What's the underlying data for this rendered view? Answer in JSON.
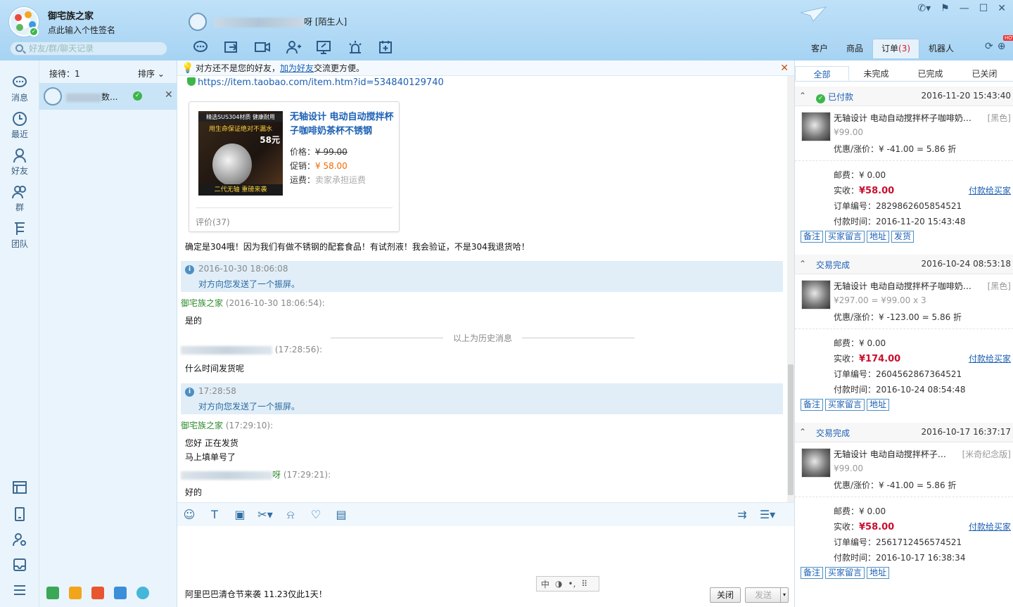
{
  "app": {
    "title": "御宅族之家",
    "signature": "点此输入个性签名",
    "search_placeholder": "好友/群/聊天记录"
  },
  "chat_header": {
    "contact_suffix": "呀",
    "contact_tag": "[陌生人]"
  },
  "right_tabs": {
    "customer": "客户",
    "goods": "商品",
    "orders": "订单",
    "orders_count": "(3)",
    "robot": "机器人",
    "hot": "HOT"
  },
  "leftnav": [
    {
      "label": "消息"
    },
    {
      "label": "最近"
    },
    {
      "label": "好友"
    },
    {
      "label": "群"
    },
    {
      "label": "团队"
    }
  ],
  "contacts": {
    "reception": "接待：1",
    "sort": "排序",
    "item_name_suffix": "数..."
  },
  "notice": {
    "text": "对方还不是您的好友，",
    "link": "加为好友",
    "after": "交流更方便。"
  },
  "messages": {
    "link": "https://item.taobao.com/item.htm?id=534840129740",
    "product": {
      "title": "无轴设计 电动自动搅拌杯子咖啡奶茶杯不锈钢",
      "price_label": "价格：",
      "price": "¥ 99.00",
      "promo_label": "促销：",
      "promo": "¥ 58.00",
      "ship_label": "运费：",
      "ship": "卖家承担运费",
      "reviews": "评价(37)",
      "img_top": "精选SUS304材质 健康耐用",
      "img_line2": "用生命保证绝对不漏水",
      "img_price": "58元",
      "img_bottom": "二代无轴 重磅来袭"
    },
    "m1": "确定是304哦！因为我们有做不锈钢的配套食品！有试剂液！我会验证，不是304我退货哈！",
    "sys1_time": "2016-10-30 18:06:08",
    "sys1_text": "对方向您发送了一个振屏。",
    "s1_name": "御宅族之家",
    "s1_time": "(2016-10-30 18:06:54):",
    "m2": "是的",
    "history": "以上为历史消息",
    "s2_time": "(17:28:56):",
    "m3": "什么时间发货呢",
    "sys2_time": "17:28:58",
    "sys2_text": "对方向您发送了一个振屏。",
    "s3_name": "御宅族之家",
    "s3_time": "(17:29:10):",
    "m4a": "您好  正在发货",
    "m4b": "马上填单号了",
    "s4_suffix": "呀",
    "s4_time": "(17:29:21):",
    "m5": "好的"
  },
  "input": {
    "ad": "阿里巴巴清仓节来袭 11.23仅此1天！",
    "close": "关闭",
    "send": "发送",
    "ime": "中"
  },
  "orders": {
    "tabs": [
      "全部",
      "未完成",
      "已完成",
      "已关闭"
    ],
    "groups": [
      {
        "status": "已付款",
        "date": "2016-11-20 15:43:40",
        "title": "无轴设计 电动自动搅拌杯子咖啡奶茶...",
        "color": "[黑色]",
        "price": "¥99.00",
        "disc": "优惠/涨价：¥ -41.00 = 5.86 折",
        "post": "邮费：¥ 0.00",
        "paid_label": "实收：",
        "paid": "¥58.00",
        "pay_link": "付款给买家",
        "order_no": "订单编号：2829862605854521",
        "pay_time": "付款时间：2016-11-20 15:43:48",
        "buttons": [
          "备注",
          "买家留言",
          "地址",
          "发货"
        ]
      },
      {
        "status": "交易完成",
        "date": "2016-10-24 08:53:18",
        "title": "无轴设计 电动自动搅拌杯子咖啡奶茶...",
        "color": "[黑色]",
        "price": "¥297.00 = ¥99.00 x 3",
        "disc": "优惠/涨价：¥ -123.00 = 5.86 折",
        "post": "邮费：¥ 0.00",
        "paid_label": "实收：",
        "paid": "¥174.00",
        "pay_link": "付款给买家",
        "order_no": "订单编号：2604562867364521",
        "pay_time": "付款时间：2016-10-24 08:54:48",
        "buttons": [
          "备注",
          "买家留言",
          "地址"
        ]
      },
      {
        "status": "交易完成",
        "date": "2016-10-17 16:37:17",
        "title": "无轴设计 电动自动搅拌杯子咖...",
        "color": "[米奇纪念版]",
        "price": "¥99.00",
        "disc": "优惠/涨价：¥ -41.00 = 5.86 折",
        "post": "邮费：¥ 0.00",
        "paid_label": "实收：",
        "paid": "¥58.00",
        "pay_link": "付款给买家",
        "order_no": "订单编号：2561712456574521",
        "pay_time": "付款时间：2016-10-17 16:38:34",
        "buttons": [
          "备注",
          "买家留言",
          "地址"
        ]
      }
    ]
  }
}
